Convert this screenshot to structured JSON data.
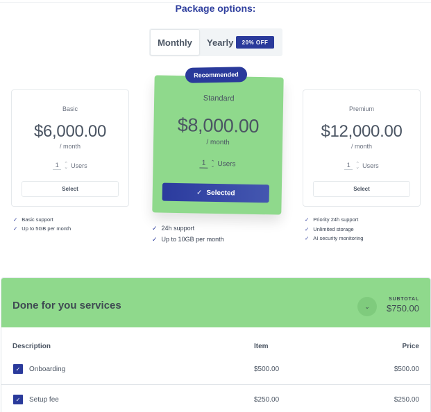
{
  "heading": "Package options:",
  "billing_toggle": {
    "options": [
      "Monthly",
      "Yearly"
    ],
    "selected": "Monthly",
    "discount_badge": "20% OFF"
  },
  "plans": [
    {
      "name": "Basic",
      "price": "$6,000.00",
      "period": "/ month",
      "users": "1",
      "users_label": "Users",
      "button_label": "Select",
      "features": [
        "Basic support",
        "Up to 5GB per month"
      ]
    },
    {
      "name": "Standard",
      "badge": "Recommended",
      "price": "$8,000.00",
      "period": "/ month",
      "users": "1",
      "users_label": "Users",
      "button_label": "Selected",
      "selected": true,
      "features": [
        "24h support",
        "Up to 10GB per month"
      ]
    },
    {
      "name": "Premium",
      "price": "$12,000.00",
      "period": "/ month",
      "users": "1",
      "users_label": "Users",
      "button_label": "Select",
      "features": [
        "Priority 24h support",
        "Unlimited storage",
        "AI security monitoring"
      ]
    }
  ],
  "services": {
    "title": "Done for you services",
    "subtotal_label": "SUBTOTAL",
    "subtotal_value": "$750.00",
    "columns": [
      "Description",
      "Item",
      "Price"
    ],
    "rows": [
      {
        "description": "Onboarding",
        "item": "$500.00",
        "price": "$500.00",
        "checked": true
      },
      {
        "description": "Setup fee",
        "item": "$250.00",
        "price": "$250.00",
        "checked": true
      }
    ]
  },
  "colors": {
    "accent": "#2a3a9b",
    "highlight_green": "#8fd98c"
  }
}
